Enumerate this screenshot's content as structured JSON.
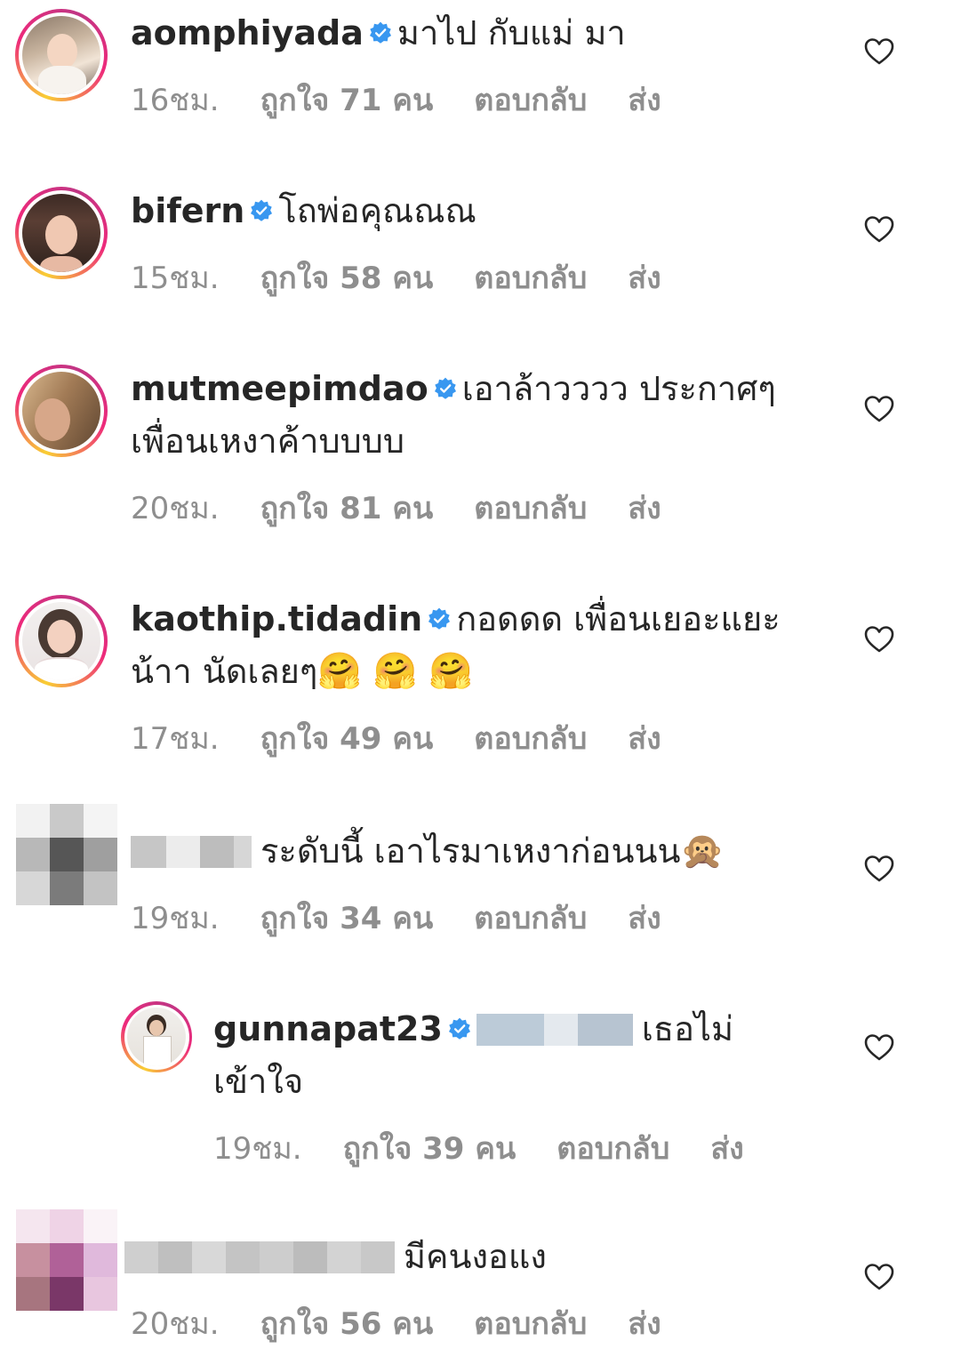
{
  "comments": [
    {
      "username": "aomphiyada",
      "text": "มาไป กับแม่ มา",
      "text2": "",
      "time": "16ชม.",
      "likes": "ถูกใจ 71 คน",
      "reply": "ตอบกลับ",
      "send": "ส่ง"
    },
    {
      "username": "bifern",
      "text": "โถพ่อคุณณณ",
      "text2": "",
      "time": "15ชม.",
      "likes": "ถูกใจ 58 คน",
      "reply": "ตอบกลับ",
      "send": "ส่ง"
    },
    {
      "username": "mutmeepimdao",
      "text": "เอาล้าวววว ประกาศๆ",
      "text2": "เพื่อนเหงาค้าบบบบ",
      "time": "20ชม.",
      "likes": "ถูกใจ 81 คน",
      "reply": "ตอบกลับ",
      "send": "ส่ง"
    },
    {
      "username": "kaothip.tidadin",
      "text": "กอดดด เพื่อนเยอะแยะ",
      "text2": "น้าา นัดเลยๆ",
      "emoji": "🤗 🤗 🤗",
      "time": "17ชม.",
      "likes": "ถูกใจ 49 คน",
      "reply": "ตอบกลับ",
      "send": "ส่ง"
    },
    {
      "username": "",
      "text": "ระดับนี้ เอาไรมาเหงาก่อนนน",
      "emoji": "🙊",
      "time": "19ชม.",
      "likes": "ถูกใจ 34 คน",
      "reply": "ตอบกลับ",
      "send": "ส่ง"
    },
    {
      "username": "gunnapat23",
      "text": "เธอไม่",
      "text2": "เข้าใจ",
      "time": "19ชม.",
      "likes": "ถูกใจ 39 คน",
      "reply": "ตอบกลับ",
      "send": "ส่ง"
    },
    {
      "username": "",
      "text": "มีคนงอแง",
      "time": "20ชม.",
      "likes": "ถูกใจ 56 คน",
      "reply": "ตอบกลับ",
      "send": "ส่ง"
    }
  ],
  "colors": {
    "verified": "#3897f0",
    "meta": "#8e8e8e",
    "text": "#262626"
  }
}
